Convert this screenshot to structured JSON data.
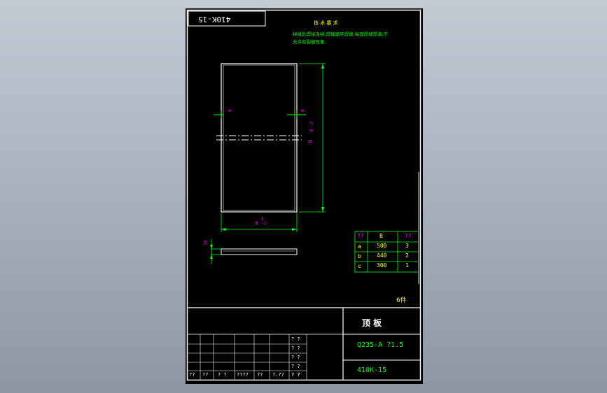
{
  "drawing": {
    "mirrored_code": "410K-15",
    "tech_req_title": "技 术 要 求",
    "tech_req_line1": "拼缝处焊接连续,焊缝磨平焊缝,每面焊缝焊满,不",
    "tech_req_line2": "允许有裂缝现象.",
    "dim_width_left": "4",
    "dim_width_right": "4",
    "dim_height": "b",
    "dim_height_tol": "0 -2",
    "dim_bottom": "a",
    "dim_bottom_tol": "0 -2",
    "dim_side": "10",
    "quantity": "6件"
  },
  "param_table": {
    "headers": [
      "??",
      "B",
      "??"
    ],
    "rows": [
      [
        "a",
        "500",
        "3"
      ],
      [
        "b",
        "440",
        "2"
      ],
      [
        "c",
        "300",
        "1"
      ]
    ]
  },
  "title_block": {
    "part_name": "顶 板",
    "material": "Q235-A ?1.5",
    "drawing_no": "410K-15",
    "small_marks": [
      "? ?",
      "? ?",
      "? ?",
      "? ?",
      "? ?"
    ],
    "bottom_row": [
      "??",
      "??",
      "? ?",
      "????",
      "??",
      "?.??",
      "? ?"
    ]
  }
}
